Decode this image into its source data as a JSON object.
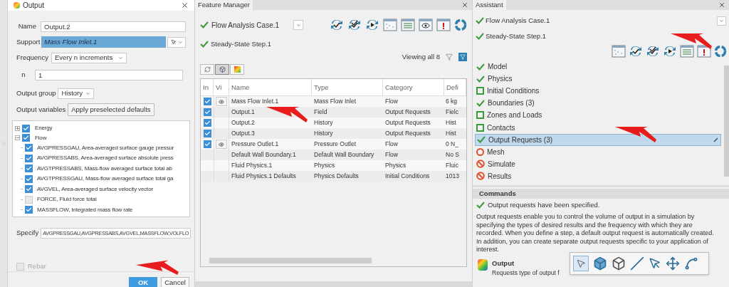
{
  "output_dialog": {
    "title": "Output",
    "name_label": "Name",
    "name_value": "Output.2",
    "support_label": "Support",
    "support_value": "Mass Flow Inlet.1",
    "frequency_label": "Frequency",
    "frequency_value": "Every n increments",
    "n_label": "n",
    "n_value": "1",
    "group_label": "Output group",
    "group_value": "History",
    "variables_label": "Output variables",
    "defaults_button": "Apply preselected defaults",
    "tree": [
      {
        "label": "Energy",
        "checked": true,
        "expanded": false
      },
      {
        "label": "Flow",
        "checked": true,
        "expanded": true,
        "children": [
          {
            "label": "AVGPRESSGAU, Area-averaged surface gauge pressur",
            "checked": true
          },
          {
            "label": "AVGPRESSABS, Area-averaged surface absolute press",
            "checked": true
          },
          {
            "label": "AVGTPRESSABS, Mass-flow averaged surface total ab",
            "checked": true
          },
          {
            "label": "AVGTPRESSGAU, Mass-flow averaged surface total ga",
            "checked": true
          },
          {
            "label": "AVGVEL, Area-averaged surface velocity vector",
            "checked": true
          },
          {
            "label": "FORCE, Fluid force total",
            "checked": false
          },
          {
            "label": "MASSFLOW, Integrated mass flow rate",
            "checked": true
          }
        ]
      }
    ],
    "specify_label": "Specify",
    "specify_value": "AVGPRESSGAU,AVGPRESSABS,AVGVEL,MASSFLOW,VOLFLO",
    "rebar_label": "Rebar",
    "rebar_checked": false,
    "ok_button": "OK",
    "cancel_button": "Cancel"
  },
  "feature_manager": {
    "tab": "Feature Manager",
    "case": "Flow Analysis Case.1",
    "step": "Steady-State Step.1",
    "viewing": "Viewing all 8",
    "columns": [
      "In",
      "Vi",
      "Name",
      "Type",
      "Category",
      "Defi"
    ],
    "rows": [
      {
        "in": true,
        "visible": true,
        "name": "Mass Flow Inlet.1",
        "type": "Mass Flow Inlet",
        "category": "Flow",
        "column_6": "6 kg"
      },
      {
        "in": true,
        "visible": false,
        "name": "Output.1",
        "type": "Field",
        "category": "Output Requests",
        "column_6": "Fielc"
      },
      {
        "in": true,
        "visible": false,
        "name": "Output.2",
        "type": "History",
        "category": "Output Requests",
        "column_6": "Hist"
      },
      {
        "in": true,
        "visible": false,
        "name": "Output.3",
        "type": "History",
        "category": "Output Requests",
        "column_6": "Hist"
      },
      {
        "in": true,
        "visible": true,
        "name": "Pressure Outlet.1",
        "type": "Pressure Outlet",
        "category": "Flow",
        "column_6": "0 N_"
      },
      {
        "visible": false,
        "name": "Default Wall Boundary.1",
        "type": "Default Wall Boundary",
        "category": "Flow",
        "column_6": "No S"
      },
      {
        "visible": false,
        "name": "Fluid Physics.1",
        "type": "Physics",
        "category": "Physics",
        "column_6": "Fluic"
      },
      {
        "visible": false,
        "name": "Fluid Physics.1 Defaults",
        "type": "Physics Defaults",
        "category": "Initial Conditions",
        "column_6": "1013"
      }
    ]
  },
  "assistant": {
    "tab": "Assistant",
    "case": "Flow Analysis Case.1",
    "step": "Steady-State Step.1",
    "steps": [
      {
        "label": "Model",
        "kind": "done",
        "selected": false
      },
      {
        "label": "Physics",
        "kind": "done",
        "selected": false
      },
      {
        "label": "Initial Conditions",
        "kind": "empty",
        "selected": false
      },
      {
        "label": "Boundaries (3)",
        "kind": "done",
        "selected": false
      },
      {
        "label": "Zones and Loads",
        "kind": "empty",
        "selected": false
      },
      {
        "label": "Contacts",
        "kind": "empty",
        "selected": false
      },
      {
        "label": "Output Requests (3)",
        "kind": "done",
        "selected": true
      },
      {
        "label": "Mesh",
        "kind": "pending",
        "selected": false
      },
      {
        "label": "Simulate",
        "kind": "blocked",
        "selected": false
      },
      {
        "label": "Results",
        "kind": "blocked",
        "selected": false
      }
    ],
    "commands_title": "Commands",
    "status": "Output requests have been specified.",
    "description": "Output requests enable you to control the volume of output in a simulation by specifying the types of desired results and the frequency with which they are recorded. When you define a step, a default output request is automatically created. In addition, you can create separate output requests specific to your application of interest.",
    "command_title": "Output",
    "command_desc": "Requests type of output f"
  }
}
